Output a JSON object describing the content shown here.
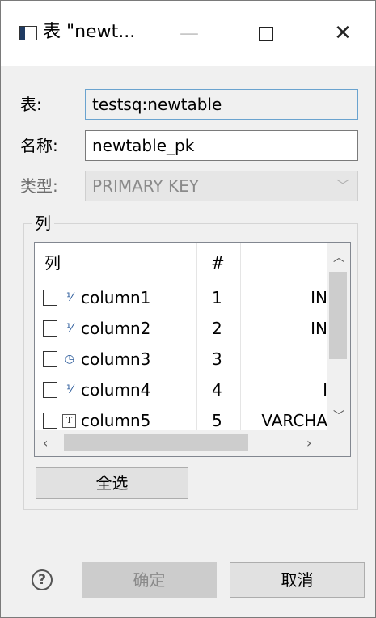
{
  "window": {
    "title": "表 \"newt...",
    "controls": {
      "minimize": "—",
      "close": "✕"
    }
  },
  "form": {
    "table_label": "表:",
    "table_value": "testsq:newtable",
    "name_label": "名称:",
    "name_value": "newtable_pk",
    "type_label": "类型:",
    "type_value": "PRIMARY KEY"
  },
  "columns_group": {
    "legend": "列",
    "headers": {
      "name": "列",
      "index": "#"
    },
    "rows": [
      {
        "icon": "numeric-column-icon",
        "glyph": "⅟",
        "name": "column1",
        "index": "1",
        "type": "IN",
        "checked": false
      },
      {
        "icon": "numeric-column-icon",
        "glyph": "⅟",
        "name": "column2",
        "index": "2",
        "type": "IN",
        "checked": false
      },
      {
        "icon": "datetime-column-icon",
        "glyph": "◷",
        "name": "column3",
        "index": "3",
        "type": "",
        "checked": false
      },
      {
        "icon": "numeric-column-icon",
        "glyph": "⅟",
        "name": "column4",
        "index": "4",
        "type": "I",
        "checked": false
      },
      {
        "icon": "text-column-icon",
        "glyph": "T",
        "name": "column5",
        "index": "5",
        "type": "VARCHA",
        "checked": false
      }
    ],
    "select_all_label": "全选"
  },
  "footer": {
    "help": "?",
    "ok_label": "确定",
    "cancel_label": "取消"
  },
  "colors": {
    "background": "#f0f0f0",
    "focus_border": "#6aa3cf",
    "disabled_text": "#8a8a8a"
  }
}
